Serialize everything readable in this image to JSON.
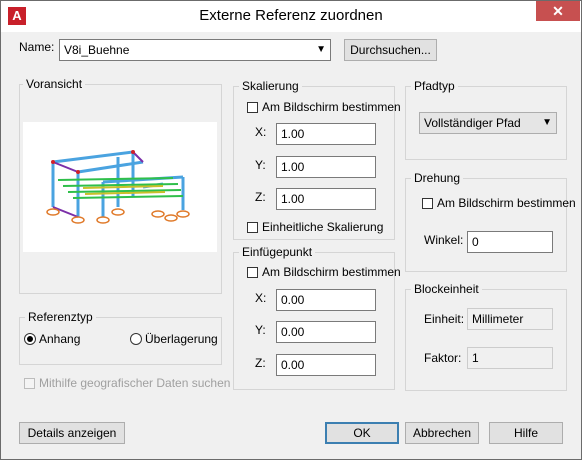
{
  "window": {
    "title": "Externe Referenz zuordnen",
    "close_glyph": "✕"
  },
  "name_row": {
    "label": "Name:",
    "value": "V8i_Buehne",
    "browse_label": "Durchsuchen..."
  },
  "preview": {
    "label": "Voransicht"
  },
  "scale": {
    "label": "Skalierung",
    "onscreen_label": "Am Bildschirm bestimmen",
    "x_label": "X:",
    "x_value": "1.00",
    "y_label": "Y:",
    "y_value": "1.00",
    "z_label": "Z:",
    "z_value": "1.00",
    "uniform_label": "Einheitliche Skalierung"
  },
  "insertion": {
    "label": "Einfügepunkt",
    "onscreen_label": "Am Bildschirm bestimmen",
    "x_label": "X:",
    "x_value": "0.00",
    "y_label": "Y:",
    "y_value": "0.00",
    "z_label": "Z:",
    "z_value": "0.00"
  },
  "path_type": {
    "label": "Pfadtyp",
    "value": "Vollständiger Pfad"
  },
  "rotation": {
    "label": "Drehung",
    "onscreen_label": "Am Bildschirm bestimmen",
    "angle_label": "Winkel:",
    "angle_value": "0"
  },
  "block_unit": {
    "label": "Blockeinheit",
    "unit_label": "Einheit:",
    "unit_value": "Millimeter",
    "factor_label": "Faktor:",
    "factor_value": "1"
  },
  "reference_type": {
    "label": "Referenztyp",
    "attach_label": "Anhang",
    "overlay_label": "Überlagerung",
    "selected": "Anhang"
  },
  "geo": {
    "label": "Mithilfe geografischer Daten suchen"
  },
  "footer": {
    "details_label": "Details anzeigen",
    "ok_label": "OK",
    "cancel_label": "Abbrechen",
    "help_label": "Hilfe"
  },
  "colors": {
    "accent": "#3c7fb1",
    "close": "#c75050",
    "app_icon": "#c8202a"
  },
  "icons": {
    "app": "autocad-logo-icon",
    "close": "close-icon",
    "dropdown": "chevron-down-icon"
  }
}
